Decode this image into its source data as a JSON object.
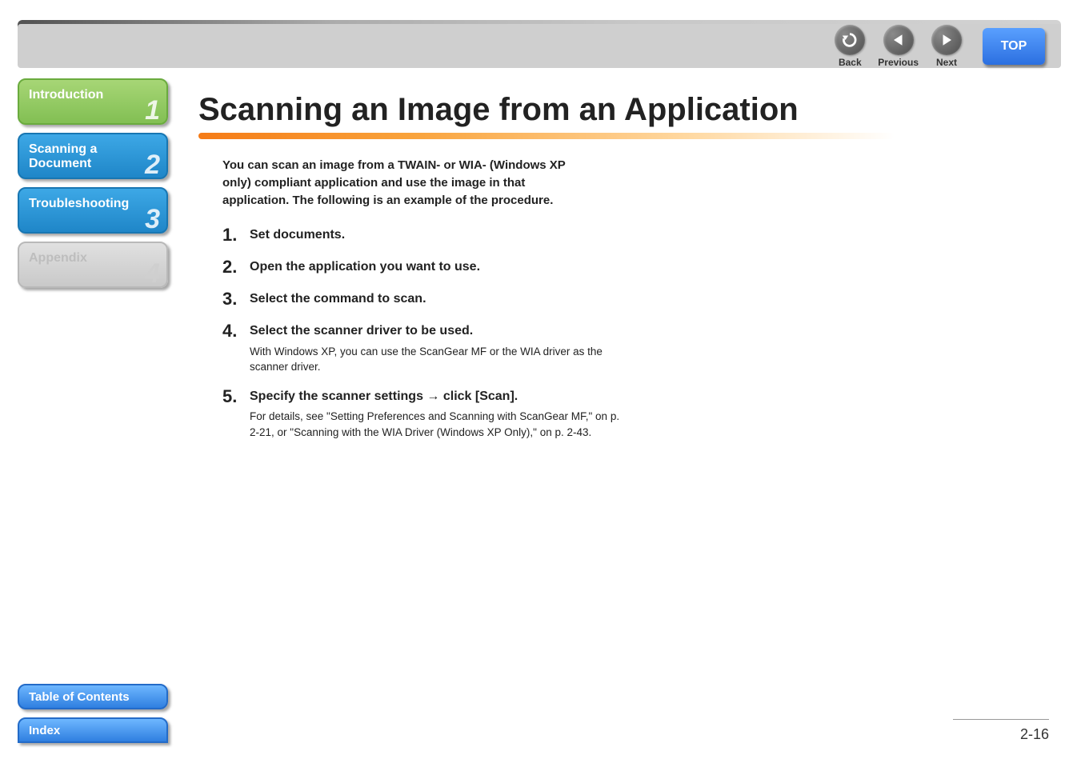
{
  "topNav": {
    "back": {
      "label": "Back"
    },
    "previous": {
      "label": "Previous"
    },
    "next": {
      "label": "Next"
    },
    "top": {
      "label": "TOP"
    }
  },
  "sidebar": {
    "items": [
      {
        "label": "Introduction",
        "num": "1"
      },
      {
        "label": "Scanning a Document",
        "num": "2"
      },
      {
        "label": "Troubleshooting",
        "num": "3"
      },
      {
        "label": "Appendix",
        "num": "4"
      }
    ],
    "toc": "Table of Contents",
    "index": "Index"
  },
  "main": {
    "title": "Scanning an Image from an Application",
    "intro": "You can scan an image from a TWAIN- or WIA- (Windows XP only) compliant application and use the image in that application. The following is an example of the procedure.",
    "steps": [
      {
        "n": "1.",
        "title": "Set documents.",
        "detail": ""
      },
      {
        "n": "2.",
        "title": "Open the application you want to use.",
        "detail": ""
      },
      {
        "n": "3.",
        "title": "Select the command to scan.",
        "detail": ""
      },
      {
        "n": "4.",
        "title": "Select the scanner driver to be used.",
        "detail": "With Windows XP, you can use the ScanGear MF or the WIA driver as the scanner driver."
      },
      {
        "n": "5.",
        "title": "Specify the scanner settings → click [Scan].",
        "detail": "For details, see \"Setting Preferences and Scanning with ScanGear MF,\" on p. 2-21, or \"Scanning with the WIA Driver (Windows XP Only),\" on p. 2-43."
      }
    ]
  },
  "pageNumber": "2-16"
}
